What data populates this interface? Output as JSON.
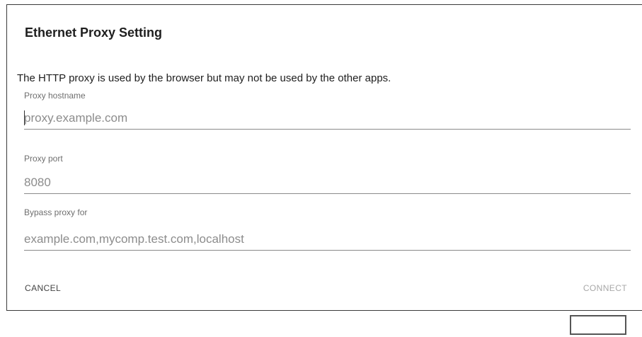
{
  "dialog": {
    "title": "Ethernet Proxy Setting",
    "message": "The HTTP proxy is used by the browser but may not be used by the other apps."
  },
  "fields": {
    "hostname": {
      "label": "Proxy hostname",
      "value": "",
      "placeholder": "proxy.example.com"
    },
    "port": {
      "label": "Proxy port",
      "value": "",
      "placeholder": "8080"
    },
    "bypass": {
      "label": "Bypass proxy for",
      "value": "",
      "placeholder": "example.com,mycomp.test.com,localhost"
    }
  },
  "buttons": {
    "cancel": "CANCEL",
    "connect": "CONNECT"
  },
  "colors": {
    "title_text": "#1e1e1e",
    "label_text": "#6f6f6f",
    "underline": "#8a8a8a",
    "connect_disabled": "#a8a8a8"
  }
}
